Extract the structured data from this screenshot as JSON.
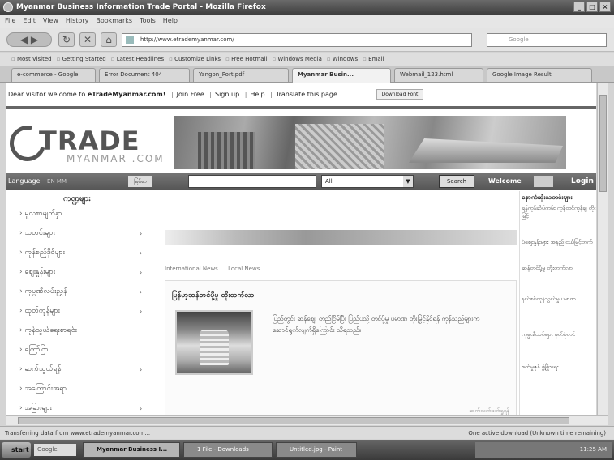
{
  "window": {
    "title": "Myanmar Business Information Trade Portal - Mozilla Firefox",
    "controls": [
      "_",
      "□",
      "×"
    ]
  },
  "menu": [
    "File",
    "Edit",
    "View",
    "History",
    "Bookmarks",
    "Tools",
    "Help"
  ],
  "nav": {
    "url": "http://www.etrademyanmar.com/",
    "search_placeholder": "Google"
  },
  "bookmarks": [
    "Most Visited",
    "Getting Started",
    "Latest Headlines",
    "Customize Links",
    "Free Hotmail",
    "Windows Media",
    "Windows",
    "Email"
  ],
  "tabs": [
    {
      "label": "e-commerce - Google"
    },
    {
      "label": "Error Document 404"
    },
    {
      "label": "Yangon_Port.pdf"
    },
    {
      "label": "Myanmar Busin...",
      "active": true
    },
    {
      "label": "Webmail_123.html"
    },
    {
      "label": "Google Image Result"
    }
  ],
  "page": {
    "welcome_prefix": "Dear visitor welcome to",
    "welcome_site": "eTradeMyanmar.com!",
    "welcome_links": [
      "Join Free",
      "Sign up",
      "Help",
      "Translate this page"
    ],
    "download_label": "Download Font",
    "logo": {
      "main": "TRADE",
      "sub": "MYANMAR .COM"
    },
    "toolbar": {
      "language_label": "Language",
      "lang_options": "EN  MM",
      "mm_badge": "မြန်မာ",
      "category_value": "All",
      "search_label": "Search",
      "welcome_label": "Welcome",
      "login_label": "Login"
    },
    "sidebar": {
      "title": "ကဏ္ဍများ",
      "items": [
        "မူလစာမျက်နှာ",
        "သတင်းများ",
        "ကုန်စည်ဒိုင်များ",
        "ဈေးနှုန်းများ",
        "ကုမ္ပဏီလမ်းညွှန်",
        "ထုတ်ကုန်များ",
        "ကုန်သွယ်ရေးစာရင်း",
        "ကြော်ငြာ",
        "ဆက်သွယ်ရန်",
        "အကြောင်းအရာ",
        "အခြားများ"
      ]
    },
    "crumbs": [
      "International News",
      "Local News"
    ],
    "article": {
      "headline": "မြန်မာ့ဆန်တင်ပို့မှု တိုးတက်လာ",
      "body": "ပြည်တွင်း ဆန်ဈေး တည်ငြိမ်ပြီး ပြည်ပသို့ တင်ပို့မှု ပမာဏ တိုးမြှင့်နိုင်ရန် ကုန်သည်များက ဆောင်ရွက်လျက်ရှိကြောင်း သိရသည်။",
      "readmore": "ဆက်လက်ဖတ်ရှုရန်"
    },
    "right": {
      "title": "နောက်ဆုံးသတင်းများ",
      "items": [
        "ရန်ကုန်ဆိပ်ကမ်း ကုန်တင်ကုန်ချ တိုးမြင့်",
        "ပဲဈေးနှုန်းများ အနည်းငယ်မြင့်တက်",
        "ဆန်တင်ပို့မှု တိုးတက်လာ",
        "နယ်စပ်ကုန်သွယ်မှု ပမာဏ",
        "ကုမ္ပဏီသစ်များ မှတ်ပုံတင်",
        "စက်မှုဇုန် ဖွံ့ဖြိုးရေး"
      ]
    }
  },
  "status": {
    "left": "Transferring data from www.etrademyanmar.com...",
    "right": "One active download (Unknown time remaining)"
  },
  "taskbar": {
    "start": "start",
    "google": "Google",
    "tasks": [
      {
        "label": "Myanmar Business I...",
        "active": true
      },
      {
        "label": "1 File - Downloads"
      },
      {
        "label": "Untitled.jpg - Paint"
      }
    ],
    "clock": "11:25 AM"
  }
}
